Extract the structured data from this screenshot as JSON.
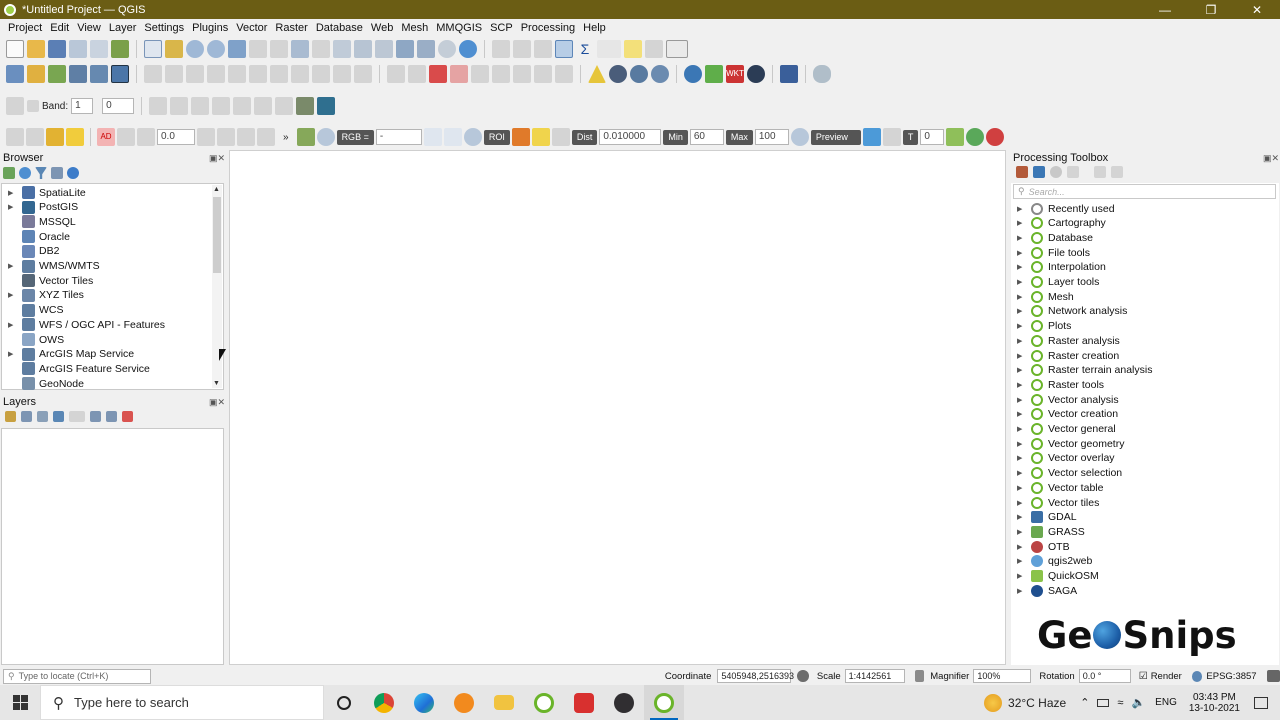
{
  "window": {
    "title": "*Untitled Project — QGIS"
  },
  "menu": [
    "Project",
    "Edit",
    "View",
    "Layer",
    "Settings",
    "Plugins",
    "Vector",
    "Raster",
    "Database",
    "Web",
    "Mesh",
    "MMQGIS",
    "SCP",
    "Processing",
    "Help"
  ],
  "toolbar3": {
    "band_label": "Band:",
    "band_value": "1",
    "band_field": "0"
  },
  "scp_toolbar": {
    "ad": "AD",
    "val1": "0.0",
    "rgb_label": "RGB =",
    "rgb_value": "-",
    "roi_label": "ROI",
    "dist_label": "Dist",
    "dist_value": "0.010000",
    "min_label": "Min",
    "min_value": "60",
    "max_label": "Max",
    "max_value": "100",
    "preview_label": "Preview",
    "t_label": "T",
    "t_value": "0",
    "more": "»"
  },
  "browser": {
    "title": "Browser",
    "items": [
      {
        "label": "SpatiaLite",
        "expand": true,
        "color": "#4a6fa5"
      },
      {
        "label": "PostGIS",
        "expand": true,
        "color": "#336791"
      },
      {
        "label": "MSSQL",
        "expand": false,
        "color": "#7a7a9a"
      },
      {
        "label": "Oracle",
        "expand": false,
        "color": "#5d84b5"
      },
      {
        "label": "DB2",
        "expand": false,
        "color": "#6a87b7"
      },
      {
        "label": "WMS/WMTS",
        "expand": true,
        "color": "#5e7da0"
      },
      {
        "label": "Vector Tiles",
        "expand": false,
        "color": "#556677"
      },
      {
        "label": "XYZ Tiles",
        "expand": true,
        "color": "#6b86a8"
      },
      {
        "label": "WCS",
        "expand": false,
        "color": "#5e7da0"
      },
      {
        "label": "WFS / OGC API - Features",
        "expand": true,
        "color": "#5e7da0"
      },
      {
        "label": "OWS",
        "expand": false,
        "color": "#8aa5c5"
      },
      {
        "label": "ArcGIS Map Service",
        "expand": true,
        "color": "#5e7da0"
      },
      {
        "label": "ArcGIS Feature Service",
        "expand": false,
        "color": "#5e7da0"
      },
      {
        "label": "GeoNode",
        "expand": false,
        "color": "#7890aa"
      }
    ]
  },
  "layers": {
    "title": "Layers"
  },
  "toolbox": {
    "title": "Processing Toolbox",
    "search_placeholder": "Search...",
    "items": [
      {
        "label": "Recently used",
        "kind": "clock"
      },
      {
        "label": "Cartography",
        "kind": "q"
      },
      {
        "label": "Database",
        "kind": "q"
      },
      {
        "label": "File tools",
        "kind": "q"
      },
      {
        "label": "Interpolation",
        "kind": "q"
      },
      {
        "label": "Layer tools",
        "kind": "q"
      },
      {
        "label": "Mesh",
        "kind": "q"
      },
      {
        "label": "Network analysis",
        "kind": "q"
      },
      {
        "label": "Plots",
        "kind": "q"
      },
      {
        "label": "Raster analysis",
        "kind": "q"
      },
      {
        "label": "Raster creation",
        "kind": "q"
      },
      {
        "label": "Raster terrain analysis",
        "kind": "q"
      },
      {
        "label": "Raster tools",
        "kind": "q"
      },
      {
        "label": "Vector analysis",
        "kind": "q"
      },
      {
        "label": "Vector creation",
        "kind": "q"
      },
      {
        "label": "Vector general",
        "kind": "q"
      },
      {
        "label": "Vector geometry",
        "kind": "q"
      },
      {
        "label": "Vector overlay",
        "kind": "q"
      },
      {
        "label": "Vector selection",
        "kind": "q"
      },
      {
        "label": "Vector table",
        "kind": "q"
      },
      {
        "label": "Vector tiles",
        "kind": "q"
      },
      {
        "label": "GDAL",
        "kind": "gdal"
      },
      {
        "label": "GRASS",
        "kind": "grass"
      },
      {
        "label": "OTB",
        "kind": "otb"
      },
      {
        "label": "qgis2web",
        "kind": "qgis2web"
      },
      {
        "label": "QuickOSM",
        "kind": "quickosm"
      },
      {
        "label": "SAGA",
        "kind": "saga"
      }
    ]
  },
  "watermark": {
    "text_left": "Ge",
    "text_right": "Snips"
  },
  "status": {
    "locator_placeholder": "Type to locate (Ctrl+K)",
    "coordinate_label": "Coordinate",
    "coordinate_value": "5405948,2516393",
    "scale_label": "Scale",
    "scale_value": "1:4142561",
    "magnifier_label": "Magnifier",
    "magnifier_value": "100%",
    "rotation_label": "Rotation",
    "rotation_value": "0.0 °",
    "render_label": "Render",
    "crs_label": "EPSG:3857"
  },
  "taskbar": {
    "search_placeholder": "Type here to search",
    "weather": "32°C  Haze",
    "lang": "ENG",
    "time": "03:43 PM",
    "date": "13-10-2021"
  }
}
